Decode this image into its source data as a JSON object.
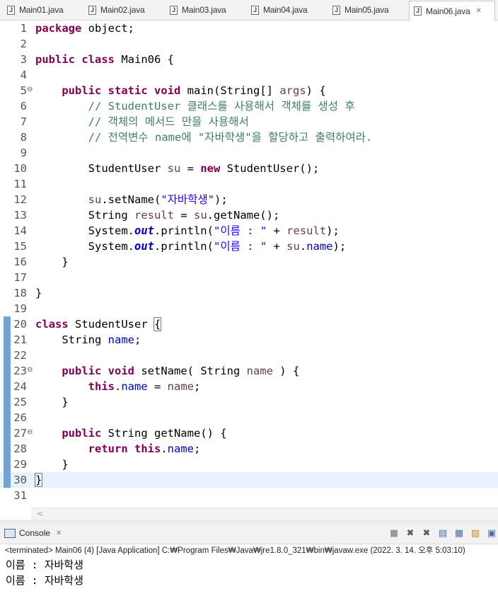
{
  "tabs": [
    {
      "label": "Main01.java",
      "active": false
    },
    {
      "label": "Main02.java",
      "active": false
    },
    {
      "label": "Main03.java",
      "active": false
    },
    {
      "label": "Main04.java",
      "active": false
    },
    {
      "label": "Main05.java",
      "active": false
    },
    {
      "label": "Main06.java",
      "active": true
    }
  ],
  "editor": {
    "lines": [
      {
        "n": "1",
        "code": "package object;"
      },
      {
        "n": "2",
        "code": ""
      },
      {
        "n": "3",
        "code": "public class Main06 {"
      },
      {
        "n": "4",
        "code": ""
      },
      {
        "n": "5",
        "code": "    public static void main(String[] args) {",
        "fold": true
      },
      {
        "n": "6",
        "code": "        // StudentUser 클래스를 사용해서 객체를 생성 후"
      },
      {
        "n": "7",
        "code": "        // 객체의 메서드 만을 사용해서"
      },
      {
        "n": "8",
        "code": "        // 전역변수 name에 \"자바학생\"을 할당하고 출력하여라."
      },
      {
        "n": "9",
        "code": ""
      },
      {
        "n": "10",
        "code": "        StudentUser su = new StudentUser();"
      },
      {
        "n": "11",
        "code": ""
      },
      {
        "n": "12",
        "code": "        su.setName(\"자바학생\");"
      },
      {
        "n": "13",
        "code": "        String result = su.getName();"
      },
      {
        "n": "14",
        "code": "        System.out.println(\"이름 : \" + result);"
      },
      {
        "n": "15",
        "code": "        System.out.println(\"이름 : \" + su.name);"
      },
      {
        "n": "16",
        "code": "    }"
      },
      {
        "n": "17",
        "code": ""
      },
      {
        "n": "18",
        "code": "}"
      },
      {
        "n": "19",
        "code": ""
      },
      {
        "n": "20",
        "code": "class StudentUser {",
        "changed": true
      },
      {
        "n": "21",
        "code": "    String name;",
        "changed": true
      },
      {
        "n": "22",
        "code": "",
        "changed": true
      },
      {
        "n": "23",
        "code": "    public void setName( String name ) {",
        "changed": true,
        "fold": true
      },
      {
        "n": "24",
        "code": "        this.name = name;",
        "changed": true
      },
      {
        "n": "25",
        "code": "    }",
        "changed": true
      },
      {
        "n": "26",
        "code": "",
        "changed": true
      },
      {
        "n": "27",
        "code": "    public String getName() {",
        "changed": true,
        "fold": true
      },
      {
        "n": "28",
        "code": "        return this.name;",
        "changed": true
      },
      {
        "n": "29",
        "code": "    }",
        "changed": true
      },
      {
        "n": "30",
        "code": "}",
        "changed": true,
        "current": true
      },
      {
        "n": "31",
        "code": ""
      }
    ]
  },
  "console": {
    "tab_label": "Console",
    "status": "<terminated> Main06 (4) [Java Application] C:₩Program Files₩Java₩jre1.8.0_321₩bin₩javaw.exe  (2022. 3. 14. 오후 5:03:10)",
    "output": [
      "이름 : 자바학생",
      "이름 : 자바학생"
    ]
  },
  "icons": {
    "file_icon": "java-file-icon",
    "close_icon": "close-icon",
    "console_icon": "console-icon",
    "toolbar": [
      "terminate-icon",
      "remove-launch-icon",
      "remove-all-terminated-icon",
      "scroll-lock-icon",
      "pin-console-icon",
      "word-wrap-icon",
      "display-selected-console-icon"
    ]
  },
  "colors": {
    "keyword": "#7f0055",
    "comment": "#3f7f5f",
    "string": "#2a00ff",
    "field": "#0000c0",
    "local_var": "#6a3e3e",
    "current_line": "#e8f2fe",
    "change_marker": "#6fa4d5"
  }
}
